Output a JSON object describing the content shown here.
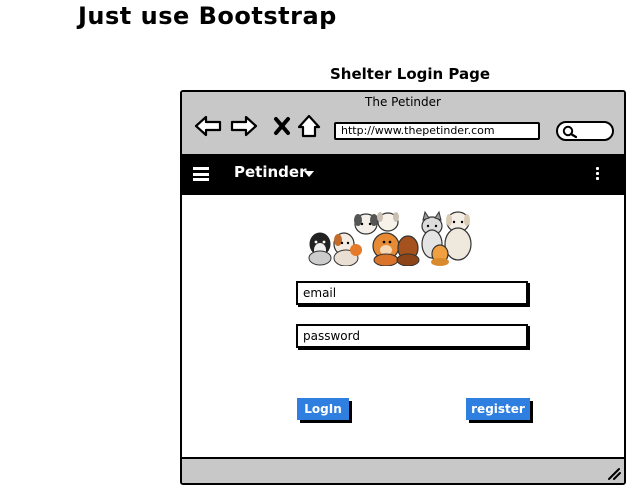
{
  "page": {
    "heading": "Just use Bootstrap",
    "subheading": "Shelter Login Page"
  },
  "browser": {
    "title": "The Petinder",
    "url": "http://www.thepetinder.com",
    "icons": {
      "back": "back-arrow-icon",
      "forward": "forward-arrow-icon",
      "stop": "stop-x-icon",
      "home": "home-icon",
      "search": "search-icon",
      "resize": "resize-grip-icon"
    }
  },
  "appbar": {
    "brand": "Petinder",
    "menu_icon": "hamburger-menu-icon",
    "dropdown_icon": "caret-down-icon",
    "overflow_icon": "kebab-menu-icon",
    "background": "#000000"
  },
  "login": {
    "logo": "dogs-group-logo",
    "email_placeholder": "email",
    "password_placeholder": "password",
    "login_label": "LogIn",
    "register_label": "register",
    "button_color": "#2f7fe0"
  }
}
